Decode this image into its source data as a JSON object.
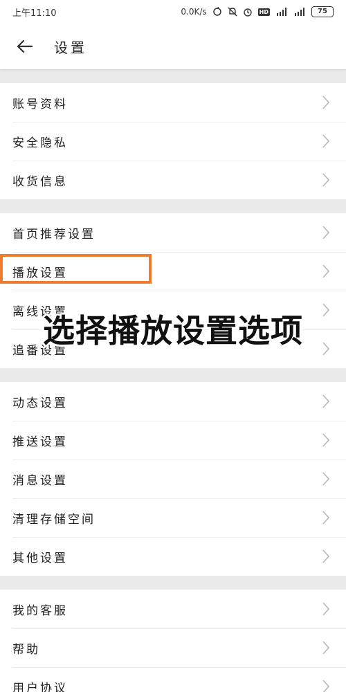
{
  "status_bar": {
    "time": "上午11:10",
    "speed": "0.0K/s",
    "hd": "HD",
    "battery": "75"
  },
  "header": {
    "title": "设置"
  },
  "sections": [
    {
      "items": [
        {
          "label": "账号资料"
        },
        {
          "label": "安全隐私"
        },
        {
          "label": "收货信息"
        }
      ]
    },
    {
      "items": [
        {
          "label": "首页推荐设置"
        },
        {
          "label": "播放设置"
        },
        {
          "label": "离线设置"
        },
        {
          "label": "追番设置"
        }
      ]
    },
    {
      "items": [
        {
          "label": "动态设置"
        },
        {
          "label": "推送设置"
        },
        {
          "label": "消息设置"
        },
        {
          "label": "清理存储空间"
        },
        {
          "label": "其他设置"
        }
      ]
    },
    {
      "items": [
        {
          "label": "我的客服"
        },
        {
          "label": "帮助"
        },
        {
          "label": "用户协议"
        }
      ]
    }
  ],
  "overlay": {
    "caption": "选择播放设置选项",
    "highlight_color": "#f07d2e"
  },
  "icons": {
    "back": "arrow-left-icon",
    "chevron": "chevron-right-icon"
  }
}
